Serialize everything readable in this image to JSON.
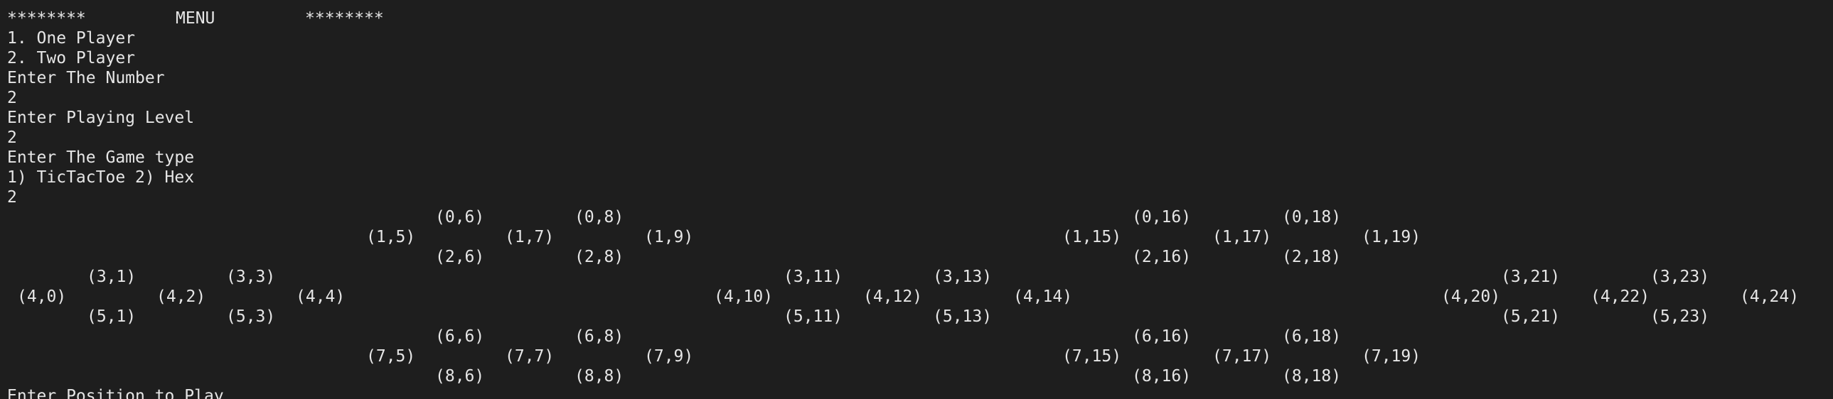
{
  "terminal": {
    "menu_left": "********",
    "menu_title": "MENU",
    "menu_right": "********",
    "option_1": "1. One Player",
    "option_2": "2. Two Player",
    "prompt_number": "Enter The Number",
    "input_number": "2",
    "prompt_level": "Enter Playing Level",
    "input_level": "2",
    "prompt_game_type": "Enter The Game type",
    "game_types": "1) TicTacToe 2) Hex",
    "input_game_type": "2",
    "prompt_position": "Enter Position to Play"
  },
  "board": {
    "row1": [
      "(0,6)",
      "(0,8)",
      "(0,16)",
      "(0,18)"
    ],
    "row2": [
      "(1,5)",
      "(1,7)",
      "(1,9)",
      "(1,15)",
      "(1,17)",
      "(1,19)"
    ],
    "row3": [
      "(2,6)",
      "(2,8)",
      "(2,16)",
      "(2,18)"
    ],
    "row4": [
      "(3,1)",
      "(3,3)",
      "(3,11)",
      "(3,13)",
      "(3,21)",
      "(3,23)"
    ],
    "row5": [
      "(4,0)",
      "(4,2)",
      "(4,4)",
      "(4,10)",
      "(4,12)",
      "(4,14)",
      "(4,20)",
      "(4,22)",
      "(4,24)"
    ],
    "row6": [
      "(5,1)",
      "(5,3)",
      "(5,11)",
      "(5,13)",
      "(5,21)",
      "(5,23)"
    ],
    "row7": [
      "(6,6)",
      "(6,8)",
      "(6,16)",
      "(6,18)"
    ],
    "row8": [
      "(7,5)",
      "(7,7)",
      "(7,9)",
      "(7,15)",
      "(7,17)",
      "(7,19)"
    ],
    "row9": [
      "(8,6)",
      "(8,8)",
      "(8,16)",
      "(8,18)"
    ]
  }
}
